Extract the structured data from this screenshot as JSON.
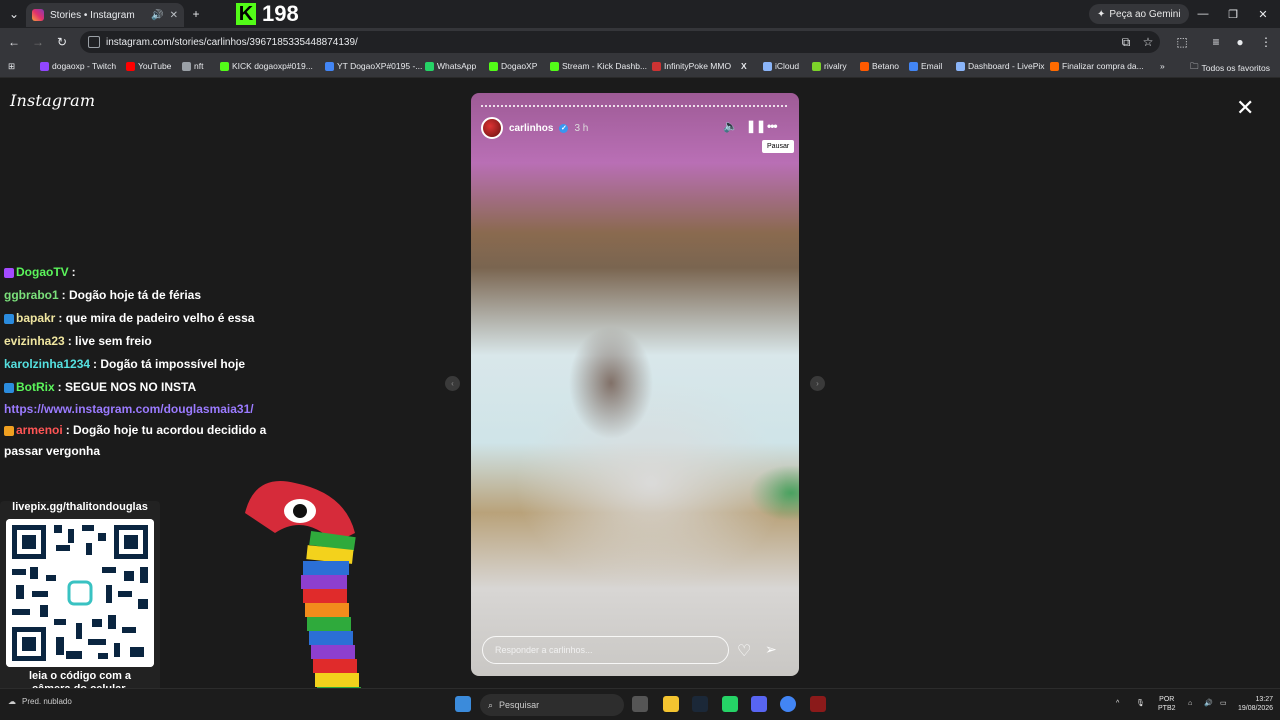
{
  "browser": {
    "tab_title": "Stories • Instagram",
    "kick_count": "198",
    "gemini_label": "Peça ao Gemini",
    "url": "instagram.com/stories/carlinhos/3967185335448874139/"
  },
  "bookmarks": [
    {
      "label": "dogaoxp - Twitch",
      "color": "#9146ff"
    },
    {
      "label": "YouTube",
      "color": "#ff0000"
    },
    {
      "label": "nft",
      "color": "#9aa0a6"
    },
    {
      "label": "KICK dogaoxp#019...",
      "color": "#53fc18"
    },
    {
      "label": "YT DogaoXP#0195 -...",
      "color": "#4285f4"
    },
    {
      "label": "WhatsApp",
      "color": "#25d366"
    },
    {
      "label": "DogaoXP",
      "color": "#53fc18"
    },
    {
      "label": "Stream - Kick Dashb...",
      "color": "#53fc18"
    },
    {
      "label": "InfinityPoke MMO",
      "color": "#cc3333"
    },
    {
      "label": "",
      "color": "#e8eaed",
      "glyph": "X"
    },
    {
      "label": "iCloud",
      "color": "#8ab4f8"
    },
    {
      "label": "rivalry",
      "color": "#7cd32a"
    },
    {
      "label": "Betano",
      "color": "#ff5a00"
    },
    {
      "label": "Email",
      "color": "#4285f4"
    },
    {
      "label": "Dashboard - LivePix",
      "color": "#8ab4f8"
    },
    {
      "label": "Finalizar compra da...",
      "color": "#ff6b00"
    }
  ],
  "bookmarks_folder": "Todos os favoritos",
  "instagram": {
    "logo": "Instagram",
    "story": {
      "username": "carlinhos",
      "time_ago": "3 h",
      "tooltip": "Pausar",
      "reply_placeholder": "Responder a carlinhos..."
    }
  },
  "chat": [
    {
      "user": "DogaoTV",
      "user_color": "#5bf55b",
      "message": ":",
      "badges": [
        "#a34bff"
      ]
    },
    {
      "user": "ggbrabo1",
      "user_color": "#7be07b",
      "message": ": Dogão hoje tá de férias",
      "badges": []
    },
    {
      "user": "bapakr",
      "user_color": "#f0e6a0",
      "message": ": que mira de padeiro velho é essa",
      "badges": [
        "#2b8cde"
      ]
    },
    {
      "user": "evizinha23",
      "user_color": "#f0e6a0",
      "message": ": live sem freio",
      "badges": []
    },
    {
      "user": "karolzinha1234",
      "user_color": "#55e0e0",
      "message": ": Dogão tá impossível hoje",
      "badges": []
    },
    {
      "user": "BotRix",
      "user_color": "#5bf55b",
      "message": ": SEGUE NOS NO INSTA",
      "badges": [
        "#2b8cde"
      ]
    },
    {
      "user": "armenoi",
      "user_color": "#ff5555",
      "message": ": Dogão hoje tu acordou decidido a",
      "badges": [
        "#f0a020"
      ]
    }
  ],
  "chat_link": "https://www.instagram.com/douglasmaia31/",
  "chat_wrap": "passar vergonha",
  "livepix": {
    "header": "livepix.gg/thalitondouglas",
    "caption_line1": "leia o código com a",
    "caption_line2": "câmera do celular."
  },
  "taskbar": {
    "weather": "Pred. nublado",
    "search_placeholder": "Pesquisar",
    "lang_line1": "POR",
    "lang_line2": "PTB2",
    "time": "13:27",
    "date": "19/08/2026"
  }
}
